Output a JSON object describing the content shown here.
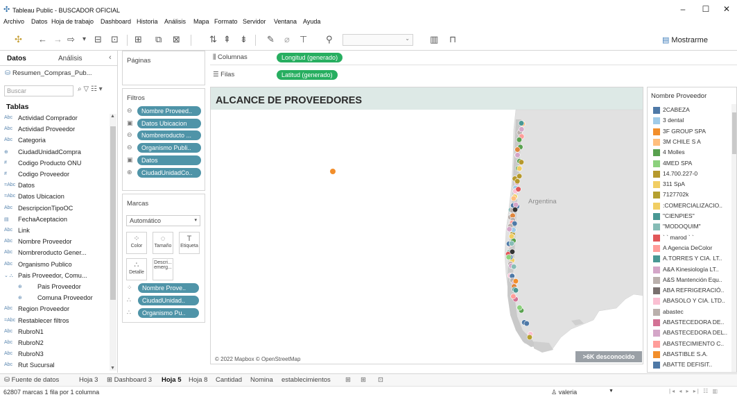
{
  "window": {
    "title": "Tableau Public - BUSCADOR OFICIAL",
    "controls": [
      "–",
      "☐",
      "✕"
    ]
  },
  "menu": [
    "Archivo",
    "Datos",
    "Hoja de trabajo",
    "Dashboard",
    "Historia",
    "Análisis",
    "Mapa",
    "Formato",
    "Servidor",
    "Ventana",
    "Ayuda"
  ],
  "toolbar": {
    "show_me_label": "Mostrarme"
  },
  "data_pane": {
    "tab_data": "Datos",
    "tab_analysis": "Análisis",
    "datasource": "Resumen_Compras_Pub...",
    "search_placeholder": "Buscar",
    "tables_heading": "Tablas",
    "fields": [
      {
        "type": "Abc",
        "label": "Actividad Comprador"
      },
      {
        "type": "Abc",
        "label": "Actividad Proveedor"
      },
      {
        "type": "Abc",
        "label": "Categoria"
      },
      {
        "type": "⊕",
        "label": "CiudadUnidadCompra"
      },
      {
        "type": "#",
        "label": "Codigo Producto ONU"
      },
      {
        "type": "#",
        "label": "Codigo Proveedor"
      },
      {
        "type": "=Abc",
        "label": "Datos"
      },
      {
        "type": "=Abc",
        "label": "Datos Ubicacion"
      },
      {
        "type": "Abc",
        "label": "DescripcionTipoOC"
      },
      {
        "type": "▤",
        "label": "FechaAceptacion"
      },
      {
        "type": "Abc",
        "label": "Link"
      },
      {
        "type": "Abc",
        "label": "Nombre Proveedor"
      },
      {
        "type": "Abc",
        "label": "Nombreroducto Gener..."
      },
      {
        "type": "Abc",
        "label": "Organismo Publico"
      },
      {
        "type": "⌄ ⛬",
        "label": "Pais Proveedor, Comu..."
      },
      {
        "type": "⊕",
        "label": "Pais Proveedor",
        "indent": true
      },
      {
        "type": "⊕",
        "label": "Comuna Proveedor",
        "indent": true
      },
      {
        "type": "Abc",
        "label": "Region Proveedor"
      },
      {
        "type": "=Abc",
        "label": "Restablecer filtros"
      },
      {
        "type": "Abc",
        "label": "RubroN1"
      },
      {
        "type": "Abc",
        "label": "RubroN2"
      },
      {
        "type": "Abc",
        "label": "RubroN3"
      },
      {
        "type": "Abc",
        "label": "Rut Sucursal"
      }
    ]
  },
  "pages_card": {
    "title": "Páginas"
  },
  "filters_card": {
    "title": "Filtros",
    "pills": [
      {
        "icon": "⊖",
        "label": "Nombre Proveed.."
      },
      {
        "icon": "▣",
        "label": "Datos Ubicacion"
      },
      {
        "icon": "⊖",
        "label": "Nombreroducto ..."
      },
      {
        "icon": "⊖",
        "label": "Organismo Publi.."
      },
      {
        "icon": "▣",
        "label": "Datos"
      },
      {
        "icon": "⊕",
        "label": "CiudadUnidadCo.."
      }
    ]
  },
  "marks_card": {
    "title": "Marcas",
    "mark_type": "Automático",
    "buttons": [
      {
        "name": "color",
        "icon": "⁘",
        "label": "Color"
      },
      {
        "name": "size",
        "icon": "◌",
        "label": "Tamaño"
      },
      {
        "name": "label",
        "icon": "T",
        "label": "Etiqueta"
      },
      {
        "name": "detail",
        "icon": "∴",
        "label": "Detalle"
      },
      {
        "name": "tooltip",
        "icon": "",
        "label": "Descri... emerg..."
      }
    ],
    "pills": [
      {
        "icon": "⁘",
        "label": "Nombre Prove.."
      },
      {
        "icon": "∴",
        "label": "CiudadUnidad.."
      },
      {
        "icon": "∴",
        "label": "Organismo Pu.."
      }
    ]
  },
  "shelves": {
    "columns_label": "Columnas",
    "columns_pill": "Longitud (generado)",
    "rows_label": "Filas",
    "rows_pill": "Latitud (generado)"
  },
  "viz": {
    "title": "ALCANCE DE PROVEEDORES",
    "map_label": "Argentina",
    "attribution": "© 2022 Mapbox © OpenStreetMap",
    "unknown_badge": ">6K desconocido"
  },
  "legend": {
    "title": "Nombre Proveedor",
    "items": [
      {
        "label": "2CABEZA",
        "color": "#4e79a7"
      },
      {
        "label": "3 dental",
        "color": "#a0cbe8"
      },
      {
        "label": "3F GROUP SPA",
        "color": "#f28e2b"
      },
      {
        "label": "3M CHILE S A",
        "color": "#ffbe7d"
      },
      {
        "label": "4 Molles",
        "color": "#59a14f"
      },
      {
        "label": "4MED SPA",
        "color": "#8cd17d"
      },
      {
        "label": "14.700.227-0",
        "color": "#b6992d"
      },
      {
        "label": "311 SpA",
        "color": "#f1ce63"
      },
      {
        "label": "7127702k",
        "color": "#b5a02f"
      },
      {
        "label": ":COMERCIALIZACIO..",
        "color": "#f1ce63"
      },
      {
        "label": "\"CIENPIES\"",
        "color": "#499894"
      },
      {
        "label": "\"MODOQUIM\"",
        "color": "#86bcb6"
      },
      {
        "label": "` ` marod ` `",
        "color": "#e15759"
      },
      {
        "label": "A Agencia DeColor",
        "color": "#ff9d9a"
      },
      {
        "label": "A.TORRES Y CIA. LT..",
        "color": "#499894"
      },
      {
        "label": "A&A Kinesiología LT..",
        "color": "#d4a6c8"
      },
      {
        "label": "A&S Mantención Equ..",
        "color": "#bab0ac"
      },
      {
        "label": "ABA REFRIGERACIÓ..",
        "color": "#79706e"
      },
      {
        "label": "ABASOLO Y CIA. LTD..",
        "color": "#fabfd2"
      },
      {
        "label": "abastec",
        "color": "#bab0ac"
      },
      {
        "label": "ABASTECEDORA DE..",
        "color": "#d37295"
      },
      {
        "label": "ABASTECEDORA DEL..",
        "color": "#d4a6c8"
      },
      {
        "label": "ABASTECIMIENTO C..",
        "color": "#ff9d9a"
      },
      {
        "label": "ABASTIBLE S.A.",
        "color": "#f28e2b"
      },
      {
        "label": "ABATTE DEFISIT..",
        "color": "#4e79a7"
      }
    ]
  },
  "sheet_tabs": {
    "data_source": "Fuente de datos",
    "tabs": [
      "Hoja 3",
      "Dashboard 3",
      "Hoja 5",
      "Hoja 8",
      "Cantidad",
      "Nomina",
      "establecimientos"
    ],
    "active": "Hoja 5"
  },
  "status": {
    "text": "62807 marcas   1 fila por 1 columna",
    "user": "valeria"
  }
}
